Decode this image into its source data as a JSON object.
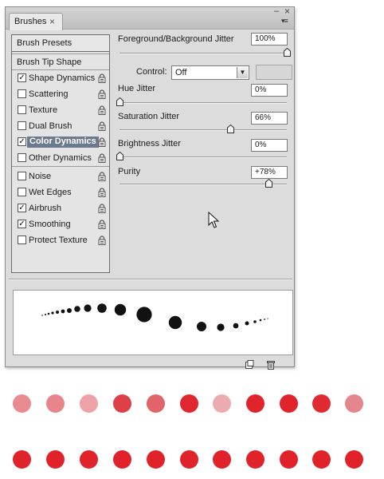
{
  "panel": {
    "tab_label": "Brushes",
    "tab_close_glyph": "×",
    "minimize_glyph": "–",
    "close_glyph": "×",
    "menu_glyph": "▾≡",
    "presets_label": "Brush Presets",
    "tip_shape_label": "Brush Tip Shape"
  },
  "options": [
    {
      "label": "Shape Dynamics",
      "checked": true,
      "check_glyph": "✓"
    },
    {
      "label": "Scattering",
      "checked": false,
      "check_glyph": ""
    },
    {
      "label": "Texture",
      "checked": false,
      "check_glyph": ""
    },
    {
      "label": "Dual Brush",
      "checked": false,
      "check_glyph": ""
    },
    {
      "label": "Color Dynamics",
      "checked": true,
      "check_glyph": "✓",
      "selected": true
    },
    {
      "label": "Other Dynamics",
      "checked": false,
      "check_glyph": ""
    },
    {
      "label": "Noise",
      "checked": false,
      "check_glyph": ""
    },
    {
      "label": "Wet Edges",
      "checked": false,
      "check_glyph": ""
    },
    {
      "label": "Airbrush",
      "checked": true,
      "check_glyph": "✓"
    },
    {
      "label": "Smoothing",
      "checked": true,
      "check_glyph": "✓"
    },
    {
      "label": "Protect Texture",
      "checked": false,
      "check_glyph": ""
    }
  ],
  "controls": {
    "fg_bg_jitter": {
      "label": "Foreground/Background Jitter",
      "value": "100%",
      "level": 1.0
    },
    "control": {
      "label": "Control:",
      "value": "Off"
    },
    "hue_jitter": {
      "label": "Hue Jitter",
      "value": "0%",
      "level": 0.0
    },
    "saturation_jitter": {
      "label": "Saturation Jitter",
      "value": "66%",
      "level": 0.66
    },
    "brightness_jitter": {
      "label": "Brightness Jitter",
      "value": "0%",
      "level": 0.0
    },
    "purity": {
      "label": "Purity",
      "value": "+78%",
      "level": 0.89
    }
  },
  "colors": {
    "accent_selected": "#6b7a8f",
    "stroke_red": "#e0202a"
  },
  "swatches_top": [
    "#e98c92",
    "#e6868c",
    "#eca2a7",
    "#de4048",
    "#e2646b",
    "#e0262e",
    "#ecabaf",
    "#e0242c",
    "#e0242c",
    "#e02a32",
    "#e5868c"
  ],
  "swatches_bottom": [
    "#e0222a",
    "#e0222a",
    "#e0222a",
    "#e0222a",
    "#e0222a",
    "#e0222a",
    "#e0222a",
    "#e0222a",
    "#e0222a",
    "#e0222a",
    "#e0222a"
  ]
}
